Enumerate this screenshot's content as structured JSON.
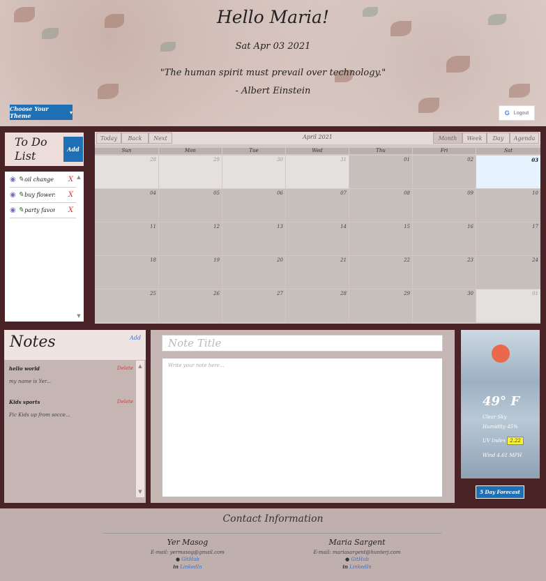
{
  "header": {
    "greeting": "Hello Maria!",
    "date": "Sat Apr 03 2021",
    "quote": "\"The human spirit must prevail over technology.\"",
    "author": "- Albert Einstein",
    "theme_button": "Choose Your Theme",
    "logout_label": "Logout"
  },
  "todo": {
    "title_line1": "To Do",
    "title_line2": "List",
    "add_label": "Add",
    "items": [
      {
        "text": "oil change"
      },
      {
        "text": "buy flowers"
      },
      {
        "text": "party favors"
      }
    ]
  },
  "calendar": {
    "today_label": "Today",
    "back_label": "Back",
    "next_label": "Next",
    "range_label": "April 2021",
    "views": [
      "Month",
      "Week",
      "Day",
      "Agenda"
    ],
    "active_view": "Month",
    "weekdays": [
      "Sun",
      "Mon",
      "Tue",
      "Wed",
      "Thu",
      "Fri",
      "Sat"
    ],
    "weeks": [
      [
        "28",
        "29",
        "30",
        "31",
        "01",
        "02",
        "03"
      ],
      [
        "04",
        "05",
        "06",
        "07",
        "08",
        "09",
        "10"
      ],
      [
        "11",
        "12",
        "13",
        "14",
        "15",
        "16",
        "17"
      ],
      [
        "18",
        "19",
        "20",
        "21",
        "22",
        "23",
        "24"
      ],
      [
        "25",
        "26",
        "27",
        "28",
        "29",
        "30",
        "01"
      ]
    ]
  },
  "notes": {
    "title": "Notes",
    "add_label": "Add",
    "items": [
      {
        "title": "hello world",
        "delete_label": "Delete",
        "body": "my name is Yer..."
      },
      {
        "title": "Kids sports",
        "delete_label": "Delete",
        "body": "Pic Kids up from socce..."
      }
    ],
    "title_placeholder": "Note Title",
    "body_placeholder": "Write your note here..."
  },
  "weather": {
    "temp": "49° F",
    "condition": "Clear Sky",
    "humidity": "Humidity 45%",
    "uv_label": "UV Index",
    "uv_value": "2.22",
    "wind": "Wind 4.61 MPH",
    "forecast_button": "5 Day Forecast"
  },
  "footer": {
    "title": "Contact Information",
    "people": [
      {
        "name": "Yer Masog",
        "email": "E-mail: yermasog@gmail.com",
        "github": "GitHub",
        "linkedin": "LinkedIn"
      },
      {
        "name": "Maria Sargent",
        "email": "E-mail: mariasargent@hunterj.com",
        "github": "GitHub",
        "linkedin": "LinkedIn"
      }
    ]
  },
  "colors": {
    "accent": "#1f6fb5",
    "page_bg": "#4a2326",
    "today": "#e6f2fd",
    "delete": "#d04040"
  }
}
